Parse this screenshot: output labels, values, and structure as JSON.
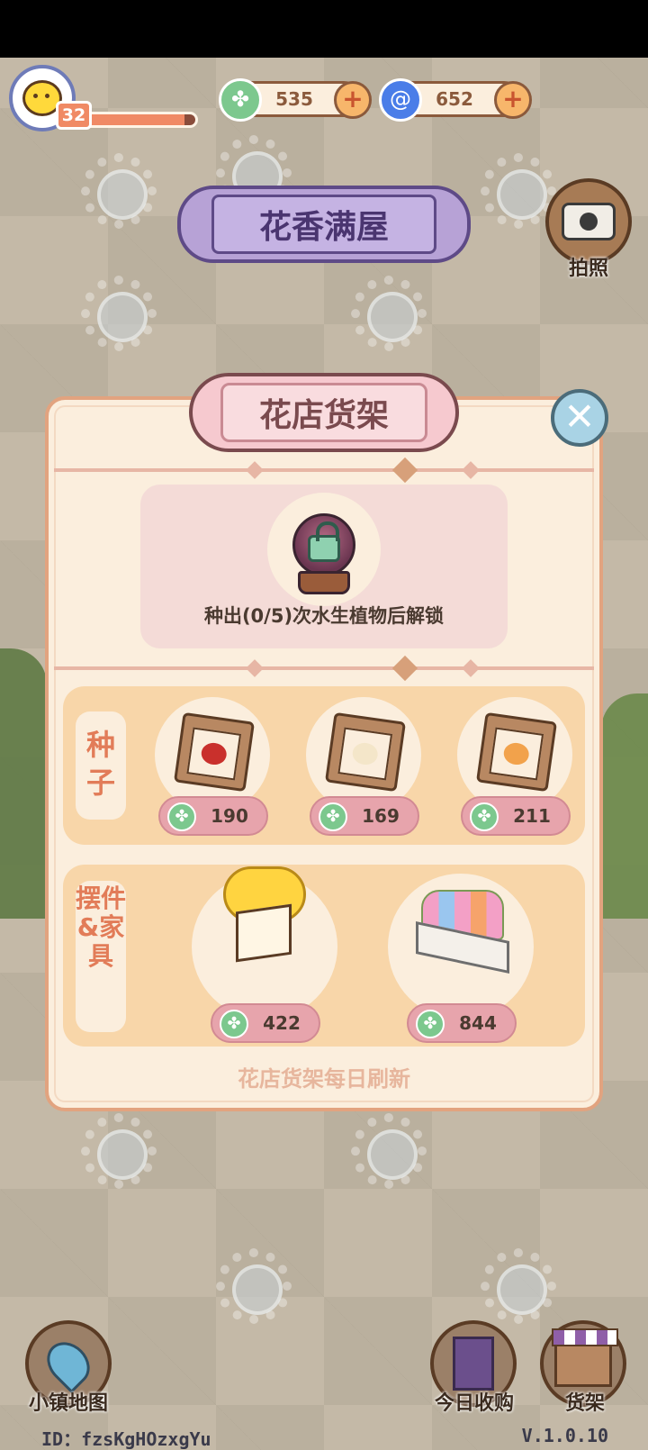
{
  "player": {
    "level": "32",
    "xp_fraction": 0.9
  },
  "currencies": [
    {
      "icon": "clover-icon",
      "amount": "535"
    },
    {
      "icon": "swirl-icon",
      "amount": "652"
    }
  ],
  "shop_sign": "花香满屋",
  "camera": {
    "label": "拍照"
  },
  "modal": {
    "title": "花店货架",
    "locked_text": "种出(0/5)次水生植物后解锁",
    "seeds_label": "种子",
    "seeds": [
      {
        "name": "red-flower-seed",
        "price": "190",
        "color": "#c9302c"
      },
      {
        "name": "water-lily-seed",
        "price": "169",
        "color": "#f4e6c9"
      },
      {
        "name": "orange-flower-seed",
        "price": "211",
        "color": "#f2a24b"
      }
    ],
    "decor_label": "摆件&家具",
    "decor": [
      {
        "name": "yellow-flower-pot",
        "price": "422"
      },
      {
        "name": "flower-planter-box",
        "price": "844"
      }
    ],
    "refresh_note": "花店货架每日刷新"
  },
  "bottom": {
    "map_label": "小镇地图",
    "purchase_label": "今日收购",
    "shelf_label": "货架",
    "user_id": "ID：fzsKgHOzxgYu",
    "version": "V.1.0.10"
  }
}
